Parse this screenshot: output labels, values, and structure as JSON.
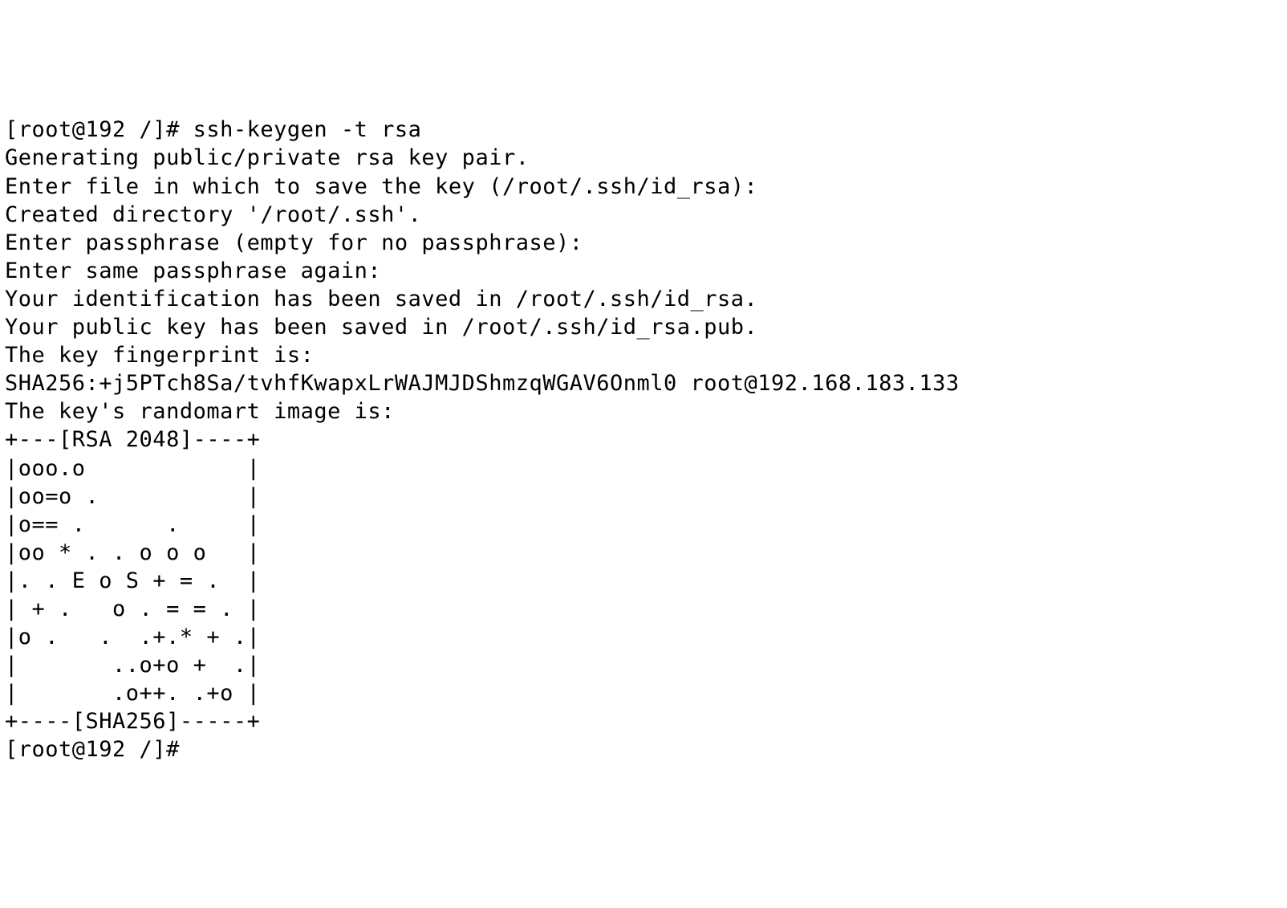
{
  "terminal": {
    "lines": [
      {
        "prompt": "[root@192 /]# ",
        "command": "ssh-keygen -t rsa",
        "text": ""
      },
      {
        "prompt": "",
        "command": "",
        "text": "Generating public/private rsa key pair."
      },
      {
        "prompt": "",
        "command": "",
        "text": "Enter file in which to save the key (/root/.ssh/id_rsa):"
      },
      {
        "prompt": "",
        "command": "",
        "text": "Created directory '/root/.ssh'."
      },
      {
        "prompt": "",
        "command": "",
        "text": "Enter passphrase (empty for no passphrase):"
      },
      {
        "prompt": "",
        "command": "",
        "text": "Enter same passphrase again:"
      },
      {
        "prompt": "",
        "command": "",
        "text": "Your identification has been saved in /root/.ssh/id_rsa."
      },
      {
        "prompt": "",
        "command": "",
        "text": "Your public key has been saved in /root/.ssh/id_rsa.pub."
      },
      {
        "prompt": "",
        "command": "",
        "text": "The key fingerprint is:"
      },
      {
        "prompt": "",
        "command": "",
        "text": "SHA256:+j5PTch8Sa/tvhfKwapxLrWAJMJDShmzqWGAV6Onml0 root@192.168.183.133"
      },
      {
        "prompt": "",
        "command": "",
        "text": "The key's randomart image is:"
      },
      {
        "prompt": "",
        "command": "",
        "text": "+---[RSA 2048]----+"
      },
      {
        "prompt": "",
        "command": "",
        "text": "|ooo.o            |"
      },
      {
        "prompt": "",
        "command": "",
        "text": "|oo=o .           |"
      },
      {
        "prompt": "",
        "command": "",
        "text": "|o== .      .     |"
      },
      {
        "prompt": "",
        "command": "",
        "text": "|oo * . . o o o   |"
      },
      {
        "prompt": "",
        "command": "",
        "text": "|. . E o S + = .  |"
      },
      {
        "prompt": "",
        "command": "",
        "text": "| + .   o . = = . |"
      },
      {
        "prompt": "",
        "command": "",
        "text": "|o .   .  .+.* + .|"
      },
      {
        "prompt": "",
        "command": "",
        "text": "|       ..o+o +  .|"
      },
      {
        "prompt": "",
        "command": "",
        "text": "|       .o++. .+o |"
      },
      {
        "prompt": "",
        "command": "",
        "text": "+----[SHA256]-----+"
      },
      {
        "prompt": "[root@192 /]# ",
        "command": "",
        "text": ""
      }
    ]
  }
}
